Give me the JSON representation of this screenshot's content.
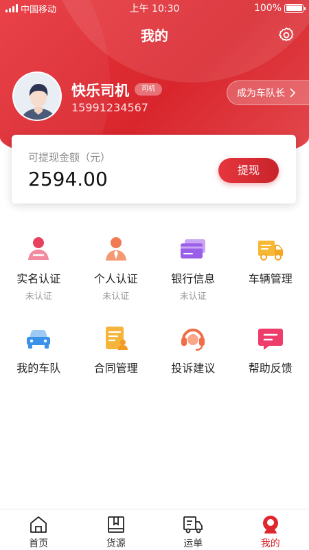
{
  "status_bar": {
    "carrier": "中国移动",
    "time": "上午 10:30",
    "battery": "100%"
  },
  "header": {
    "title": "我的"
  },
  "profile": {
    "name": "快乐司机",
    "role": "司机",
    "phone": "15991234567",
    "captain_button": "成为车队长"
  },
  "balance": {
    "label": "可提现金额（元）",
    "amount": "2594.00",
    "withdraw_button": "提现"
  },
  "grid": {
    "row1": [
      {
        "label": "实名认证",
        "sub": "未认证",
        "icon": "id-person-icon"
      },
      {
        "label": "个人认证",
        "sub": "未认证",
        "icon": "person-tie-icon"
      },
      {
        "label": "银行信息",
        "sub": "未认证",
        "icon": "bank-card-icon"
      },
      {
        "label": "车辆管理",
        "sub": "",
        "icon": "truck-icon"
      }
    ],
    "row2": [
      {
        "label": "我的车队",
        "icon": "car-icon"
      },
      {
        "label": "合同管理",
        "icon": "contract-icon"
      },
      {
        "label": "投诉建议",
        "icon": "headset-icon"
      },
      {
        "label": "帮助反馈",
        "icon": "message-icon"
      }
    ]
  },
  "bottom_nav": [
    {
      "label": "首页",
      "icon": "home-icon"
    },
    {
      "label": "货源",
      "icon": "bookmark-book-icon"
    },
    {
      "label": "运单",
      "icon": "waybill-truck-icon"
    },
    {
      "label": "我的",
      "icon": "mine-avatar-icon",
      "active": true
    }
  ],
  "colors": {
    "primary_red": "#d9262d",
    "text_gray": "#999999"
  }
}
